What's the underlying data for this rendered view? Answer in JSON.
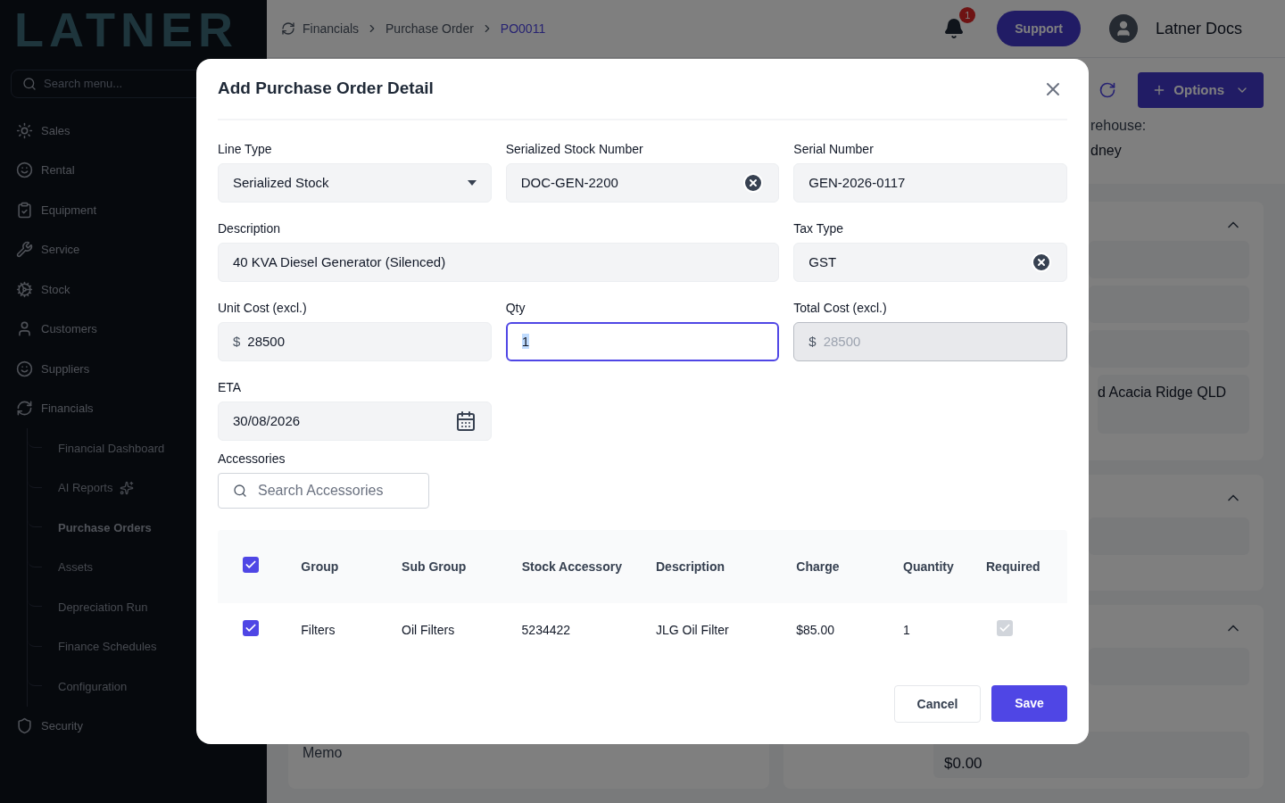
{
  "sidebar": {
    "logo": "LATNER",
    "search": {
      "placeholder": "Search menu..."
    },
    "items": [
      {
        "label": "Sales"
      },
      {
        "label": "Rental"
      },
      {
        "label": "Equipment"
      },
      {
        "label": "Service"
      },
      {
        "label": "Stock"
      },
      {
        "label": "Customers"
      },
      {
        "label": "Suppliers"
      },
      {
        "label": "Financials",
        "children": [
          {
            "label": "Financial Dashboard",
            "selected": false
          },
          {
            "label": "AI Reports",
            "selected": false
          },
          {
            "label": "Purchase Orders",
            "selected": true
          },
          {
            "label": "Assets",
            "selected": false
          },
          {
            "label": "Depreciation Run",
            "selected": false
          },
          {
            "label": "Finance Schedules",
            "selected": false
          },
          {
            "label": "Configuration",
            "selected": false
          }
        ]
      },
      {
        "label": "Security"
      }
    ]
  },
  "header": {
    "breadcrumbs": [
      {
        "label": "Financials",
        "current": false
      },
      {
        "label": "Purchase Order",
        "current": false
      },
      {
        "label": "PO0011",
        "current": true
      }
    ],
    "notification_count": "1",
    "support": "Support",
    "user": "Latner Docs"
  },
  "background": {
    "options": "Options",
    "warehouse_label": "rehouse:",
    "warehouse_value": "dney",
    "address": "d Acacia Ridge QLD",
    "memo": "Memo",
    "received_value": "$0.00"
  },
  "modal": {
    "title": "Add Purchase Order Detail",
    "fields": [
      {
        "label": "Line Type",
        "value": "Serialized Stock",
        "kind": "select",
        "focused": false,
        "disabled": false
      },
      {
        "label": "Serialized Stock Number",
        "value": "DOC-GEN-2200",
        "kind": "clearable",
        "focused": false,
        "disabled": false
      },
      {
        "label": "Serial Number",
        "value": "GEN-2026-0117",
        "kind": "text",
        "focused": false,
        "disabled": false
      },
      {
        "label": "Description",
        "value": "40 KVA Diesel Generator (Silenced)",
        "kind": "text",
        "focused": false,
        "disabled": false
      },
      {
        "label": "Tax Type",
        "value": "GST",
        "kind": "clearable",
        "focused": false,
        "disabled": false
      },
      {
        "label": "Unit Cost (excl.)",
        "prefix": "$",
        "value": "28500",
        "kind": "text",
        "focused": false,
        "disabled": false
      },
      {
        "label": "Qty",
        "value": "1",
        "kind": "text",
        "focused": true,
        "disabled": false
      },
      {
        "label": "Total Cost (excl.)",
        "prefix": "$",
        "value": "28500",
        "kind": "text",
        "focused": false,
        "disabled": true
      },
      {
        "label": "ETA",
        "value": "30/08/2026",
        "kind": "date",
        "focused": false,
        "disabled": false
      }
    ],
    "accessories": {
      "label": "Accessories",
      "placeholder": "Search Accessories",
      "table": {
        "all_selected": true,
        "columns": [
          "Group",
          "Sub Group",
          "Stock Accessory",
          "Description",
          "Charge",
          "Quantity",
          "Required"
        ],
        "rows": [
          {
            "selected": true,
            "cells": [
              "Filters",
              "Oil Filters",
              "5234422",
              "JLG Oil Filter",
              "$85.00",
              "1"
            ],
            "required": true
          }
        ]
      }
    },
    "cancel": "Cancel",
    "save": "Save"
  }
}
